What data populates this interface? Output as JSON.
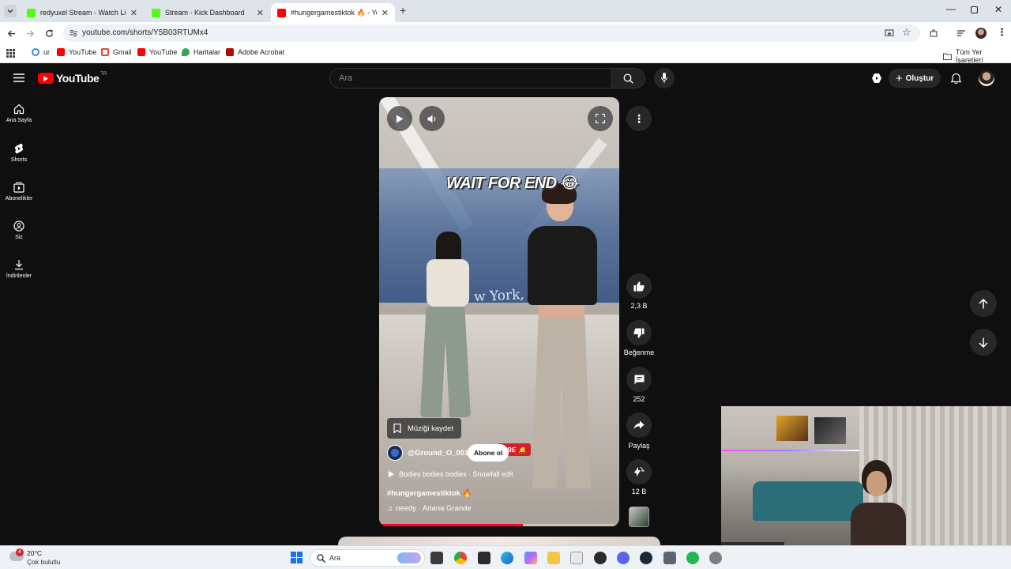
{
  "browser": {
    "tabs": [
      {
        "title": "redyuxel Stream - Watch Live o",
        "favicon_color": "#53fc18",
        "active": false
      },
      {
        "title": "Stream - Kick Dashboard",
        "favicon_color": "#53fc18",
        "active": false
      },
      {
        "title": "#hungergamestiktok 🔥 - YouTube",
        "favicon_color": "#ff0000",
        "active": true
      }
    ],
    "new_tab": "+",
    "url": "youtube.com/shorts/Y5B03RTUMx4",
    "bookmarks": [
      {
        "label": "ur",
        "color": "#4285f4"
      },
      {
        "label": "YouTube",
        "color": "#ff0000"
      },
      {
        "label": "Gmail",
        "color": "#ea4335"
      },
      {
        "label": "YouTube",
        "color": "#ff0000"
      },
      {
        "label": "Haritalar",
        "color": "#34a853"
      },
      {
        "label": "Adobe Acrobat",
        "color": "#b30b00"
      }
    ],
    "all_bookmarks": "Tüm Yer İşaretleri"
  },
  "youtube": {
    "logo_text": "YouTube",
    "country": "TR",
    "search_placeholder": "Ara",
    "create_label": "Oluştur",
    "sidebar": [
      {
        "label": "Ana Sayfa",
        "icon": "home-icon"
      },
      {
        "label": "Shorts",
        "icon": "shorts-icon"
      },
      {
        "label": "Abonelikler",
        "icon": "subscriptions-icon"
      },
      {
        "label": "Siz",
        "icon": "you-icon"
      },
      {
        "label": "İndirilenler",
        "icon": "downloads-icon"
      }
    ],
    "short": {
      "overlay_text": "WAIT FOR END 😂",
      "save_music": "Müziği kaydet",
      "channel": "@Ground_O_001",
      "subscribe": "Abone ol",
      "subscribe_badge": "RIBE",
      "playlist": "Bodies bodies bodies · Snowfall edit",
      "title": "#hungergamestiktok 🔥",
      "music": "needy · Ariana Grande",
      "progress": 0.6,
      "background_sign": "w York, This is"
    },
    "actions": {
      "likes": "2,3 B",
      "dislike": "Beğenme",
      "comments": "252",
      "share": "Paylaş",
      "remix": "12 B"
    }
  },
  "taskbar": {
    "weather_temp": "20°C",
    "weather_desc": "Çok bulutlu",
    "weather_badge": "4",
    "search": "Ara"
  }
}
